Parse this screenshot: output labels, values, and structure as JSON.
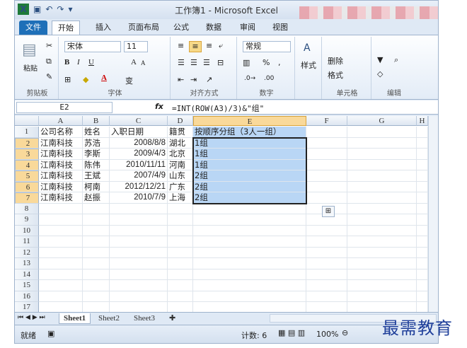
{
  "window": {
    "title": "工作簿1 - Microsoft Excel",
    "app_icon": "X"
  },
  "ribbon_tabs": [
    "文件",
    "开始",
    "插入",
    "页面布局",
    "公式",
    "数据",
    "审阅",
    "视图"
  ],
  "ribbon": {
    "clipboard": {
      "label": "剪贴板",
      "paste": "粘贴"
    },
    "font": {
      "label": "字体",
      "font_name": "宋体",
      "font_size": "11",
      "bold": "B",
      "italic": "I",
      "underline": "U",
      "grow": "A",
      "shrink": "A",
      "fill": "A",
      "phonetic": "变"
    },
    "alignment": {
      "label": "对齐方式"
    },
    "number": {
      "label": "数字",
      "format": "常规",
      "percent": "%",
      "comma": ","
    },
    "styles": {
      "label": "样式"
    },
    "cells": {
      "label": "单元格",
      "delete": "删除",
      "format": "格式"
    },
    "editing": {
      "label": "编辑"
    }
  },
  "formula_bar": {
    "name_box": "E2",
    "fx": "fx",
    "formula": "=INT(ROW(A3)/3)&\"组\""
  },
  "columns": [
    "A",
    "B",
    "C",
    "D",
    "E",
    "F",
    "G",
    "H"
  ],
  "rows": [
    "1",
    "2",
    "3",
    "4",
    "5",
    "6",
    "7",
    "8",
    "9",
    "10",
    "11",
    "12",
    "13",
    "14",
    "15",
    "16",
    "17"
  ],
  "table": {
    "header": [
      "公司名称",
      "姓名",
      "入职日期",
      "籍贯",
      "按顺序分组（3人一组）"
    ],
    "data": [
      [
        "江南科技",
        "苏浩",
        "2008/8/8",
        "湖北",
        "1组"
      ],
      [
        "江南科技",
        "李斯",
        "2009/4/3",
        "北京",
        "1组"
      ],
      [
        "江南科技",
        "陈伟",
        "2010/11/11",
        "河南",
        "1组"
      ],
      [
        "江南科技",
        "王斌",
        "2007/4/9",
        "山东",
        "2组"
      ],
      [
        "江南科技",
        "柯南",
        "2012/12/21",
        "广东",
        "2组"
      ],
      [
        "江南科技",
        "赵振",
        "2010/7/9",
        "上海",
        "2组"
      ]
    ]
  },
  "sheets": [
    "Sheet1",
    "Sheet2",
    "Sheet3"
  ],
  "active_sheet": "Sheet1",
  "status": {
    "mode": "就绪",
    "count": "计数: 6",
    "zoom": "100%"
  },
  "watermark": "最需教育"
}
